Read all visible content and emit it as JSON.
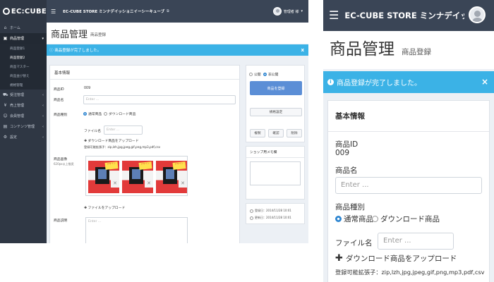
{
  "desktop": {
    "logo": "EC:CUBE",
    "store_name": "EC-CUBE STORE ミンナデイッショニイーシーキューブ",
    "user_name": "管理者 様",
    "nav": [
      {
        "icon": "home-icon",
        "glyph": "⌂",
        "label": "ホーム"
      },
      {
        "icon": "box-icon",
        "glyph": "▣",
        "label": "商品管理"
      },
      {
        "icon": "cart-icon",
        "glyph": "⛟",
        "label": "受注管理"
      },
      {
        "icon": "yen-icon",
        "glyph": "¥",
        "label": "売上管理"
      },
      {
        "icon": "users-icon",
        "glyph": "☺",
        "label": "会員管理"
      },
      {
        "icon": "file-icon",
        "glyph": "▤",
        "label": "コンテンツ管理"
      },
      {
        "icon": "gear-icon",
        "glyph": "⚙",
        "label": "設定"
      }
    ],
    "subnav": [
      "商品登録1",
      "商品登録2",
      "商品マスター",
      "商品並び替え",
      "規格管理"
    ],
    "page_title": "商品管理",
    "page_subtitle": "商品登録",
    "alert": "商品登録が完了しました。",
    "close": "x",
    "basic_info": "基本情報",
    "labels": {
      "product_id": "商品ID",
      "product_name": "商品名",
      "product_type": "商品種別",
      "file_name": "ファイル名",
      "product_image": "商品画像",
      "image_note": "620px以上推奨",
      "description": "商品説明"
    },
    "product_id_value": "009",
    "enter_placeholder": "Enter ...",
    "type_options": [
      "通常商品",
      "ダウンロード商品"
    ],
    "upload_download": "ダウンロード商品をアップロード",
    "extensions": "登録可能拡張子：zip,lzh,jpg,jpeg,gif,png,mp3,pdf,csv",
    "upload_file": "ファイルをアップロード",
    "thumb_text": [
      "デザイン",
      "デザイン",
      "デザイン"
    ],
    "visibility": [
      "公開",
      "非公開"
    ],
    "register_button": "商品を登録",
    "spec_button": "規格設定",
    "action_buttons": [
      "複製",
      "確認",
      "削除"
    ],
    "shop_memo": "ショップ用メモ欄",
    "registered_at": "登録日：2014/11/28 10:01",
    "updated_at": "更新日：2014/11/28 10:01",
    "colors": {
      "sidebar": "#2f3744",
      "topbar": "#3a4556",
      "alert": "#3bb2e6",
      "primary": "#5b8ed6"
    }
  },
  "mobile": {
    "store_name": "EC-CUBE STORE ミンナデイッシ...",
    "page_title": "商品管理",
    "page_subtitle": "商品登録",
    "alert": "商品登録が完了しました。",
    "close": "×",
    "basic_info": "基本情報",
    "product_id_label": "商品ID",
    "product_id_value": "009",
    "product_name_label": "商品名",
    "enter_placeholder": "Enter ...",
    "product_type_label": "商品種別",
    "type_options": [
      "通常商品",
      "ダウンロード商品"
    ],
    "file_name_label": "ファイル名",
    "upload_download": "ダウンロード商品をアップロード",
    "extensions": "登録可能拡張子：zip,lzh,jpg,jpeg,gif,png,mp3,pdf,csv"
  }
}
